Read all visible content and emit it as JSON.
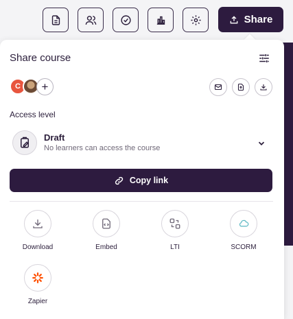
{
  "toolbar": {
    "icons": [
      "document-icon",
      "users-icon",
      "check-circle-icon",
      "bar-chart-icon",
      "gear-icon"
    ],
    "share_label": "Share"
  },
  "panel": {
    "title": "Share course",
    "avatar_initial": "C",
    "add_label": "+",
    "access_level_label": "Access level",
    "access": {
      "title": "Draft",
      "subtitle": "No learners can access the course"
    },
    "copy_link_label": "Copy link",
    "options": [
      {
        "label": "Download",
        "icon": "download-icon"
      },
      {
        "label": "Embed",
        "icon": "embed-icon"
      },
      {
        "label": "LTI",
        "icon": "lti-icon"
      },
      {
        "label": "SCORM",
        "icon": "scorm-cloud-icon"
      },
      {
        "label": "Zapier",
        "icon": "zapier-icon"
      }
    ]
  },
  "colors": {
    "brand": "#2d1b3f",
    "avatar": "#e8553e",
    "zapier": "#ff4f00",
    "scorm": "#5ab7c2"
  }
}
